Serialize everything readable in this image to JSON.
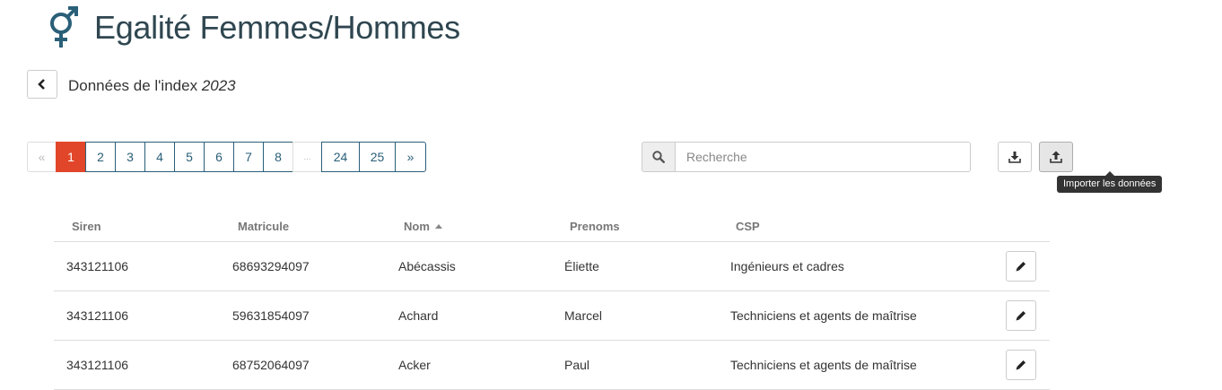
{
  "header": {
    "title": "Egalité Femmes/Hommes",
    "icon": "gender-equality-icon",
    "icon_color": "#2a5f78"
  },
  "subheader": {
    "back_icon": "chevron-left-icon",
    "label": "Données de l'index",
    "year": "2023"
  },
  "pagination": {
    "items": [
      {
        "label": "«",
        "state": "disabled"
      },
      {
        "label": "1",
        "state": "active"
      },
      {
        "label": "2",
        "state": "normal"
      },
      {
        "label": "3",
        "state": "normal"
      },
      {
        "label": "4",
        "state": "normal"
      },
      {
        "label": "5",
        "state": "normal"
      },
      {
        "label": "6",
        "state": "normal"
      },
      {
        "label": "7",
        "state": "normal"
      },
      {
        "label": "8",
        "state": "normal"
      },
      {
        "label": "...",
        "state": "disabled"
      },
      {
        "label": "24",
        "state": "normal"
      },
      {
        "label": "25",
        "state": "normal"
      },
      {
        "label": "»",
        "state": "normal"
      }
    ],
    "active_color": "#e2462a"
  },
  "search": {
    "placeholder": "Recherche",
    "value": ""
  },
  "toolbar": {
    "download_icon": "download-icon",
    "import_icon": "upload-icon",
    "import_tooltip": "Importer les données"
  },
  "table": {
    "columns": [
      {
        "label": "Siren",
        "sorted": false
      },
      {
        "label": "Matricule",
        "sorted": false
      },
      {
        "label": "Nom",
        "sorted": true
      },
      {
        "label": "Prenoms",
        "sorted": false
      },
      {
        "label": "CSP",
        "sorted": false
      }
    ],
    "rows": [
      {
        "siren": "343121106",
        "matricule": "68693294097",
        "nom": "Abécassis",
        "prenoms": "Éliette",
        "csp": "Ingénieurs et cadres"
      },
      {
        "siren": "343121106",
        "matricule": "59631854097",
        "nom": "Achard",
        "prenoms": "Marcel",
        "csp": "Techniciens et agents de maîtrise"
      },
      {
        "siren": "343121106",
        "matricule": "68752064097",
        "nom": "Acker",
        "prenoms": "Paul",
        "csp": "Techniciens et agents de maîtrise"
      }
    ]
  }
}
